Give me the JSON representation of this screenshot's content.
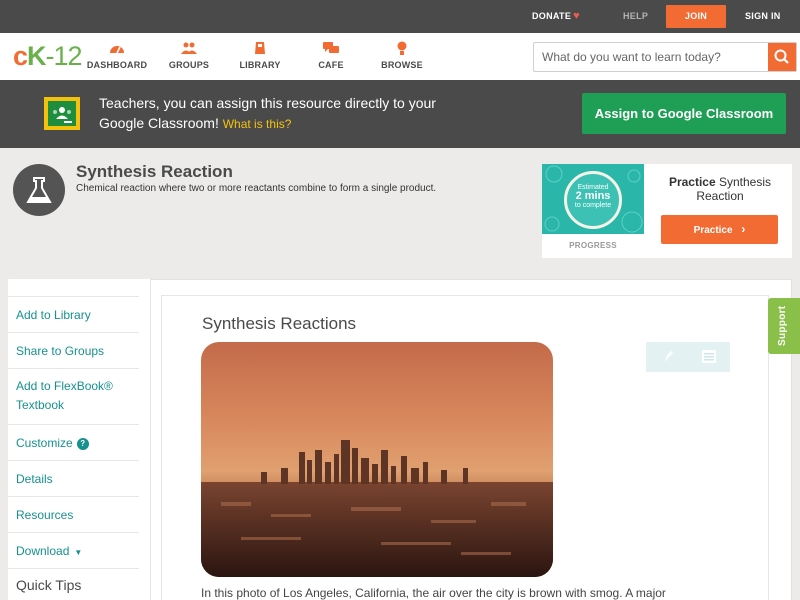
{
  "topbar": {
    "donate": "DONATE",
    "help": "HELP",
    "join": "JOIN",
    "signin": "SIGN IN"
  },
  "logo": {
    "c": "c",
    "k": "K",
    "dash": "-",
    "num": "12"
  },
  "nav": {
    "items": [
      {
        "label": "DASHBOARD",
        "icon": "dashboard-icon"
      },
      {
        "label": "GROUPS",
        "icon": "groups-icon"
      },
      {
        "label": "LIBRARY",
        "icon": "library-icon"
      },
      {
        "label": "CAFE",
        "icon": "cafe-icon"
      },
      {
        "label": "BROWSE",
        "icon": "browse-icon"
      }
    ]
  },
  "search": {
    "placeholder": "What do you want to learn today?"
  },
  "classroom": {
    "message": "Teachers, you can assign this resource directly to your Google Classroom!",
    "what": "What is this?",
    "button": "Assign to Google Classroom"
  },
  "concept": {
    "title": "Synthesis Reaction",
    "description": "Chemical reaction where two or more reactants combine to form a single product."
  },
  "practice": {
    "estimated": "Estimated",
    "mins": "2 mins",
    "complete": "to complete",
    "progress_label": "PROGRESS",
    "title_bold": "Practice",
    "title_rest": "Synthesis Reaction",
    "button": "Practice"
  },
  "sidebar": {
    "items": [
      {
        "label": "Add to Library"
      },
      {
        "label": "Share to Groups"
      },
      {
        "label": "Add to FlexBook® Textbook"
      },
      {
        "label": "Customize"
      },
      {
        "label": "Details"
      },
      {
        "label": "Resources"
      },
      {
        "label": "Download"
      }
    ],
    "quick_tips": "Quick Tips"
  },
  "article": {
    "title": "Synthesis Reactions",
    "text": "In this photo of Los Angeles, California, the air over the city is brown with smog. A major"
  },
  "support": "Support",
  "colors": {
    "accent_orange": "#f26b33",
    "classroom_green": "#1f9e55",
    "link_teal": "#16918f",
    "support_green": "#8ac04a"
  }
}
